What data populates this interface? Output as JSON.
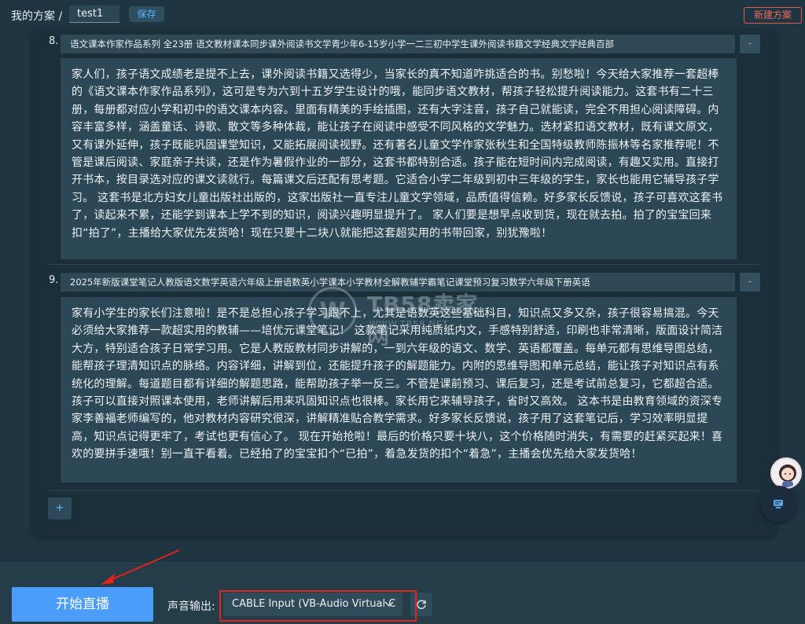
{
  "header": {
    "breadcrumb": "我的方案 /",
    "scheme_name": "test1",
    "save_label": "保存",
    "new_scheme_label": "新建方案"
  },
  "items": [
    {
      "number": "8.",
      "title": "语文课本作家作品系列 全23册 语文教材课本同步课外阅读书文学青少年6-15岁小学一二三初中学生课外阅读书籍文学经典文学经典百部",
      "body": "家人们，孩子语文成绩老是提不上去，课外阅读书籍又选得少，当家长的真不知道咋挑适合的书。别愁啦！今天给大家推荐一套超棒的《语文课本作家作品系列》，这可是专为六到十五岁学生设计的哦，能同步语文教材，帮孩子轻松提升阅读能力。这套书有二十三册，每册都对应小学和初中的语文课本内容。里面有精美的手绘插图，还有大字注音，孩子自己就能读，完全不用担心阅读障碍。内容丰富多样，涵盖童话、诗歌、散文等多种体裁，能让孩子在阅读中感受不同风格的文学魅力。选材紧扣语文教材，既有课文原文，又有课外延伸，孩子既能巩固课堂知识，又能拓展阅读视野。还有著名儿童文学作家张秋生和全国特级教师陈振林等名家推荐呢！不管是课后阅读、家庭亲子共读，还是作为暑假作业的一部分，这套书都特别合适。孩子能在短时间内完成阅读，有趣又实用。直接打开书本，按目录选对应的课文读就行。每篇课文后还配有思考题。它适合小学二年级到初中三年级的学生，家长也能用它辅导孩子学习。 这套书是北方妇女儿童出版社出版的，这家出版社一直专注儿童文学领域，品质值得信赖。好多家长反馈说，孩子可喜欢这套书了，读起来不累，还能学到课本上学不到的知识，阅读兴趣明显提升了。 家人们要是想早点收到货，现在就去拍。拍了的宝宝回来扣“拍了”，主播给大家优先发货哈！现在只要十二块八就能把这套超实用的书带回家，别犹豫啦！"
    },
    {
      "number": "9.",
      "title": "2025年新版课堂笔记人教版语文数学英语六年级上册语数英小学课本小学教材全解教辅学霸笔记课堂预习复习数学六年级下册英语",
      "body": "家有小学生的家长们注意啦！是不是总担心孩子学习跟不上，尤其是语数英这些基础科目，知识点又多又杂，孩子很容易搞混。今天必须给大家推荐一款超实用的教辅——培优元课堂笔记！ 这款笔记采用纯质纸内文，手感特别舒适，印刷也非常清晰，版面设计简洁大方，特别适合孩子日常学习用。它是人教版教材同步讲解的，一到六年级的语文、数学、英语都覆盖。每单元都有思维导图总结，能帮孩子理清知识点的脉络。内容详细，讲解到位，还能提升孩子的解题能力。内附的思维导图和单元总结，能让孩子对知识点有系统化的理解。每道题目都有详细的解题思路，能帮助孩子举一反三。不管是课前预习、课后复习，还是考试前总复习，它都超合适。孩子可以直接对照课本使用，老师讲解后用来巩固知识点也很棒。家长用它来辅导孩子，省时又高效。 这本书是由教育领域的资深专家李善福老师编写的，他对教材内容研究很深，讲解精准贴合教学需求。好多家长反馈说，孩子用了这套笔记后，学习效率明显提高，知识点记得更牢了，考试也更有信心了。 现在开始抢啦！最后的价格只要十块八，这个价格随时消失，有需要的赶紧买起来！喜欢的要拼手速哦！别一直干看着。已经拍了的宝宝扣个“已拍”，着急发货的扣个“着急”，主播会优先给大家发货哈！"
    }
  ],
  "controls": {
    "remove_label": "-",
    "add_label": "+",
    "start_live_label": "开始直播",
    "audio_output_label": "声音输出:",
    "audio_output_value": "CABLE Input (VB-Audio Virtual C"
  },
  "watermark": {
    "title": "TB58卖家网",
    "subtitle": "WWW.TB58.NET"
  },
  "colors": {
    "accent": "#4b9dfb",
    "danger": "#e5231b",
    "background": "#1f3542",
    "panel": "#1b2f3b"
  }
}
